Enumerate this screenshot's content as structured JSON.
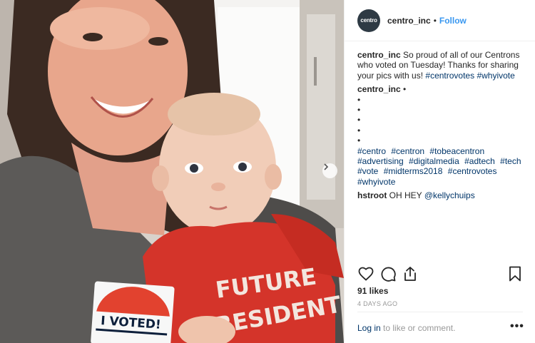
{
  "post": {
    "username": "centro_inc",
    "avatar_text": "centro",
    "follow_label": "Follow",
    "caption_text": "So proud of all of our Centrons who voted on Tuesday! Thanks for sharing your pics with us!",
    "caption_tags": [
      "#centrovotes",
      "#whyivote"
    ],
    "comment2_username": "centro_inc",
    "comment2_bullets": [
      "•",
      "•",
      "•",
      "•",
      "•",
      "•"
    ],
    "comment2_tags": [
      "#centro",
      "#centron",
      "#tobeacentron",
      "#advertising",
      "#digitalmedia",
      "#adtech",
      "#tech",
      "#vote",
      "#midterms2018",
      "#centrovotes",
      "#whyivote"
    ],
    "comment3_username": "hstroot",
    "comment3_text": "OH HEY",
    "comment3_mention": "@kellychuips",
    "likes": "91 likes",
    "date": "4 DAYS AGO",
    "login_link": "Log in",
    "login_text": "to like or comment.",
    "more_label": "•••"
  },
  "photo": {
    "sticker_text": "I VOTED!",
    "shirt_text_line1": "FUTURE",
    "shirt_text_line2": "PRESIDENT"
  },
  "icons": {
    "heart": "heart-icon",
    "comment": "comment-icon",
    "share": "share-icon",
    "bookmark": "bookmark-icon",
    "next": "chevron-right-icon"
  },
  "colors": {
    "link_blue": "#3897f0",
    "tag_blue": "#003569",
    "text": "#262626",
    "muted": "#999999"
  }
}
